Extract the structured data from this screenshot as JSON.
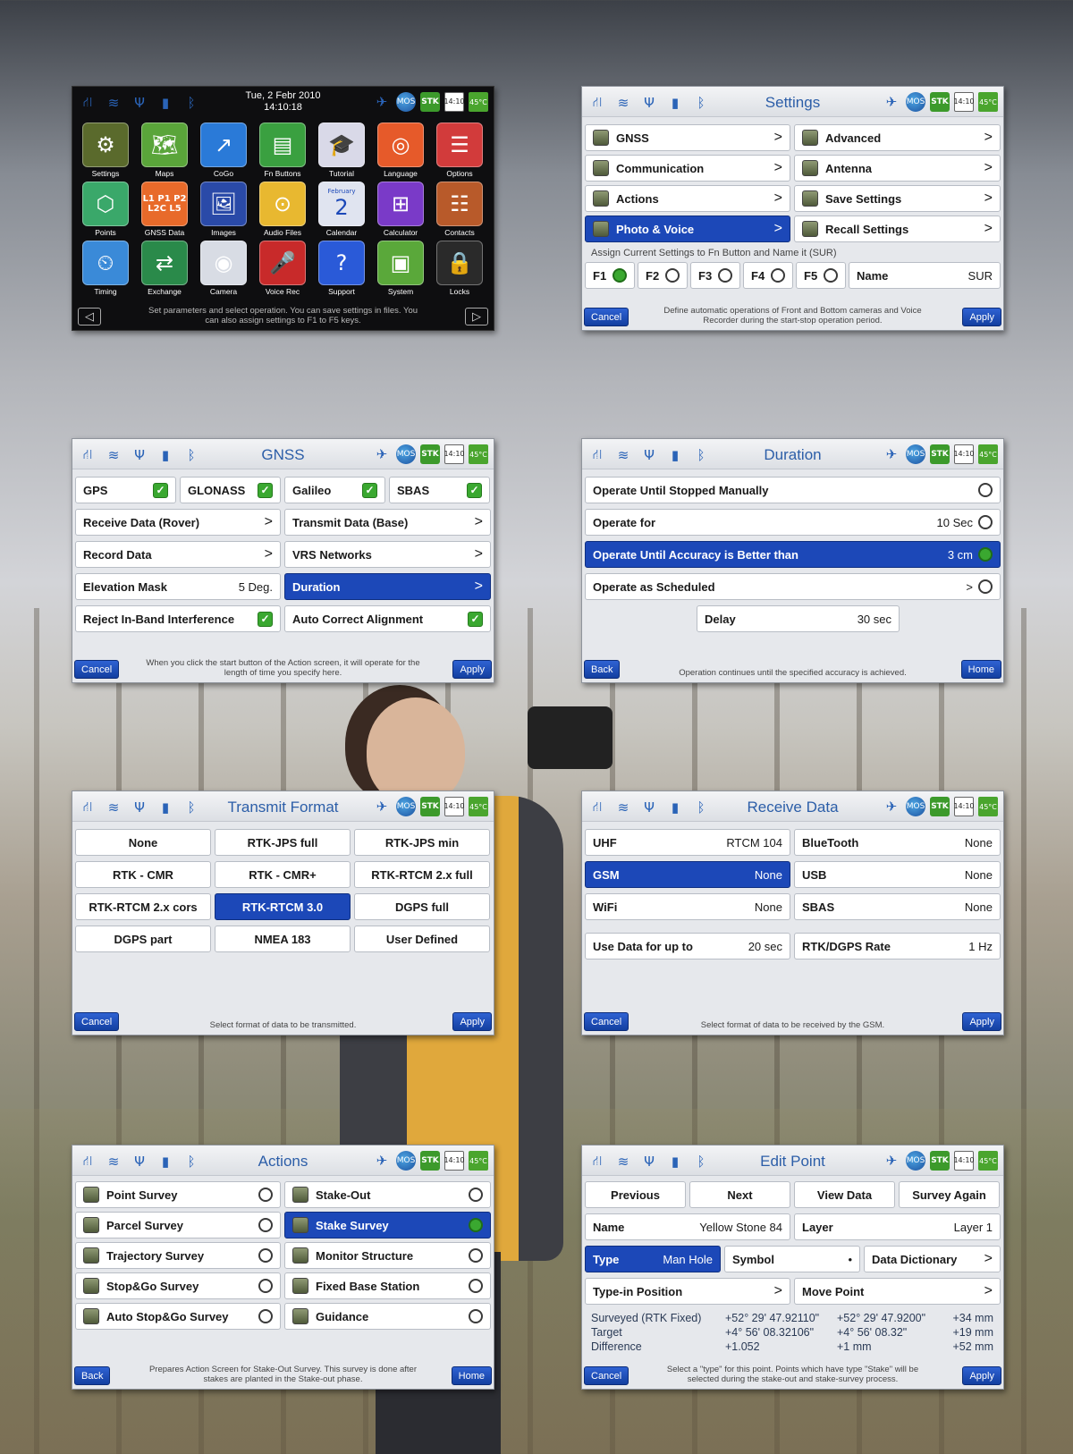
{
  "status_icons": {
    "left": [
      "network-icon",
      "wifi-icon",
      "antenna-icon",
      "signal-icon",
      "bluetooth-icon"
    ],
    "sats": "20",
    "sats_b": "25",
    "time": "14:10",
    "temp": "45°C",
    "rtk": "STK",
    "mos": "MOS",
    "f1": "F1"
  },
  "home": {
    "date": "Tue, 2 Febr 2010",
    "time": "14:10:18",
    "apps": [
      "Settings",
      "Maps",
      "CoGo",
      "Fn Buttons",
      "Tutorial",
      "Language",
      "Options",
      "Points",
      "GNSS Data",
      "Images",
      "Audio Files",
      "Calendar",
      "Calculator",
      "Contacts",
      "Timing",
      "Exchange",
      "Camera",
      "Voice Rec",
      "Support",
      "System",
      "Locks"
    ],
    "gnss_tile": "L1 P1 P2 L2C L5",
    "cal_month": "February",
    "cal_day": "2",
    "hint": "Set parameters and select operation. You can save settings in files. You can also assign settings to F1 to F5 keys."
  },
  "settings": {
    "title": "Settings",
    "left": [
      "GNSS",
      "Communication",
      "Actions",
      "Photo & Voice"
    ],
    "right": [
      "Advanced",
      "Antenna",
      "Save Settings",
      "Recall Settings"
    ],
    "assign": "Assign Current Settings to Fn Button and Name it (SUR)",
    "fkeys": [
      "F1",
      "F2",
      "F3",
      "F4",
      "F5"
    ],
    "name_label": "Name",
    "name_value": "SUR",
    "cancel": "Cancel",
    "apply": "Apply",
    "hint": "Define automatic operations of Front and Bottom cameras and Voice Recorder during the start-stop operation period."
  },
  "gnss": {
    "title": "GNSS",
    "systems": [
      "GPS",
      "GLONASS",
      "Galileo",
      "SBAS"
    ],
    "rows": [
      [
        "Receive Data (Rover)",
        "Transmit Data (Base)"
      ],
      [
        "Record Data",
        "VRS Networks"
      ]
    ],
    "elev": "Elevation Mask",
    "elev_val": "5 Deg.",
    "duration": "Duration",
    "reject": "Reject In-Band Interference",
    "auto": "Auto Correct Alignment",
    "cancel": "Cancel",
    "apply": "Apply",
    "hint": "When you click the start button of the Action screen, it will operate for the length of time you specify here."
  },
  "duration": {
    "title": "Duration",
    "r1": "Operate Until Stopped Manually",
    "r2": "Operate for",
    "r2v": "10 Sec",
    "r3": "Operate Until Accuracy is Better than",
    "r3v": "3 cm",
    "r4": "Operate as Scheduled",
    "r4v": ">",
    "delay": "Delay",
    "delay_v": "30 sec",
    "back": "Back",
    "home": "Home",
    "hint": "Operation continues until the specified accuracy is achieved."
  },
  "tformat": {
    "title": "Transmit Format",
    "cells": [
      "None",
      "RTK-JPS full",
      "RTK-JPS min",
      "RTK - CMR",
      "RTK - CMR+",
      "RTK-RTCM 2.x full",
      "RTK-RTCM 2.x cors",
      "RTK-RTCM 3.0",
      "DGPS full",
      "DGPS part",
      "NMEA 183",
      "User Defined"
    ],
    "cancel": "Cancel",
    "apply": "Apply",
    "hint": "Select format of data to be transmitted."
  },
  "receive": {
    "title": "Receive Data",
    "rows": [
      [
        "UHF",
        "RTCM 104",
        "BlueTooth",
        "None"
      ],
      [
        "GSM",
        "None",
        "USB",
        "None"
      ],
      [
        "WiFi",
        "None",
        "SBAS",
        "None"
      ],
      [
        "Use Data for up to",
        "20 sec",
        "RTK/DGPS Rate",
        "1 Hz"
      ]
    ],
    "cancel": "Cancel",
    "apply": "Apply",
    "hint": "Select format of data to be received by the GSM."
  },
  "actions": {
    "title": "Actions",
    "left": [
      "Point Survey",
      "Parcel Survey",
      "Trajectory Survey",
      "Stop&Go Survey",
      "Auto Stop&Go Survey"
    ],
    "right": [
      "Stake-Out",
      "Stake Survey",
      "Monitor Structure",
      "Fixed Base Station",
      "Guidance"
    ],
    "back": "Back",
    "home": "Home",
    "hint": "Prepares Action Screen for Stake-Out Survey. This survey is done after stakes are planted in the Stake-out phase."
  },
  "edit": {
    "title": "Edit Point",
    "tabs": [
      "Previous",
      "Next",
      "View Data",
      "Survey Again"
    ],
    "name": "Name",
    "name_v": "Yellow Stone 84",
    "layer": "Layer",
    "layer_v": "Layer 1",
    "type": "Type",
    "type_v": "Man Hole",
    "symbol": "Symbol",
    "symbol_v": "•",
    "dd": "Data Dictionary",
    "tip": "Type-in Position",
    "mp": "Move Point",
    "rows": [
      [
        "Surveyed (RTK Fixed)",
        "+52° 29' 47.92110\"",
        "+52° 29' 47.9200\"",
        "+34 mm"
      ],
      [
        "Target",
        "+4° 56' 08.32106\"",
        "+4° 56' 08.32\"",
        "+19 mm"
      ],
      [
        "Difference",
        "+1.052",
        "+1 mm",
        "+52 mm"
      ]
    ],
    "cancel": "Cancel",
    "apply": "Apply",
    "hint": "Select a \"type\" for this point. Points which have type \"Stake\" will be selected during the stake-out and stake-survey process."
  }
}
